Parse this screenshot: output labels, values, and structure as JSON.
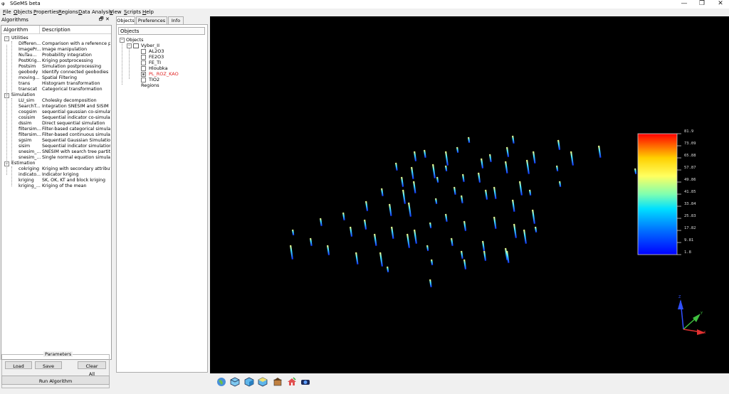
{
  "window": {
    "title": "SGeMS beta",
    "app_icon_text": "𝛗",
    "min_glyph": "—",
    "max_glyph": "❐",
    "close_glyph": "✕"
  },
  "menu": [
    "File",
    "Objects",
    "Properties",
    "Regions",
    "Data Analysis",
    "View",
    "Scripts",
    "Help"
  ],
  "algorithms": {
    "title": "Algorithms",
    "float_glyph": "🗗",
    "close_glyph": "✕",
    "columns": [
      "Algorithm",
      "Description"
    ],
    "groups": [
      {
        "name": "Utilities",
        "items": [
          [
            "Differen...",
            "Comparison with a reference p..."
          ],
          [
            "ImagePr...",
            "Image manipulation"
          ],
          [
            "NuTau...",
            "Probability integration"
          ],
          [
            "PostKrig...",
            "Kriging postprocessing"
          ],
          [
            "Postsim",
            "Simulation postprocessing"
          ],
          [
            "geobody",
            "Identify connected geobodies"
          ],
          [
            "moving...",
            "Spatial Filtering"
          ],
          [
            "trans",
            "Histogram transformation"
          ],
          [
            "transcat",
            "Categorical transformation"
          ]
        ]
      },
      {
        "name": "Simulation",
        "items": [
          [
            "LU_sim",
            "Cholesky decomposition"
          ],
          [
            "SearchT...",
            "Integration SNESIM and SISIM"
          ],
          [
            "cosgsim",
            "sequential gaussian co-simulat..."
          ],
          [
            "cosisim",
            "Sequential indicator co-simulat..."
          ],
          [
            "dssim",
            "Direct sequential simulation"
          ],
          [
            "filtersim...",
            "Filter-based categorical simulat..."
          ],
          [
            "filtersim...",
            "Filter-based continuous simula..."
          ],
          [
            "sgsim",
            "Sequential Gaussian Simulation"
          ],
          [
            "sisim",
            "Sequential indicator simulation"
          ],
          [
            "snesim_...",
            "SNESIM with search tree partiti..."
          ],
          [
            "snesim_...",
            "Single normal equation simulat..."
          ]
        ]
      },
      {
        "name": "Estimation",
        "items": [
          [
            "cokriging",
            "Kriging with secondary attribute"
          ],
          [
            "indicato...",
            "Indicator kriging"
          ],
          [
            "kriging",
            "SK, OK, KT and block kriging"
          ],
          [
            "kriging_...",
            "Kriging of the mean"
          ]
        ]
      }
    ],
    "parameters_label": "Parameters",
    "load_label": "Load",
    "save_label": "Save",
    "clear_label": "Clear All",
    "run_label": "Run Algorithm"
  },
  "objects_panel": {
    "tabs": [
      "Objects",
      "Preferences",
      "Info"
    ],
    "header": "Objects",
    "root": "Objects",
    "grid": "Vyber_II",
    "properties": [
      {
        "name": "AL2O3",
        "checked": false,
        "color": "#000000"
      },
      {
        "name": "FE2O3",
        "checked": false,
        "color": "#000000"
      },
      {
        "name": "FE_TI",
        "checked": false,
        "color": "#000000"
      },
      {
        "name": "Hloubka",
        "checked": false,
        "color": "#000000"
      },
      {
        "name": "PL_ROZ_KAO",
        "checked": true,
        "color": "#e02020"
      },
      {
        "name": "TIO2",
        "checked": false,
        "color": "#000000"
      }
    ],
    "regions": "Regions"
  },
  "colorbar": {
    "labels": [
      "81.9",
      "73.09",
      "65.88",
      "57.87",
      "49.86",
      "41.85",
      "33.84",
      "25.83",
      "17.82",
      "9.81",
      "1.8"
    ]
  },
  "axes": {
    "z": "Z",
    "y": "Y",
    "x": "X"
  },
  "toolbar_icons": [
    "globe-icon",
    "cube-view-icon",
    "cube-side-icon",
    "cube-top-icon",
    "camera-icon",
    "home-icon",
    "screenshot-icon"
  ]
}
